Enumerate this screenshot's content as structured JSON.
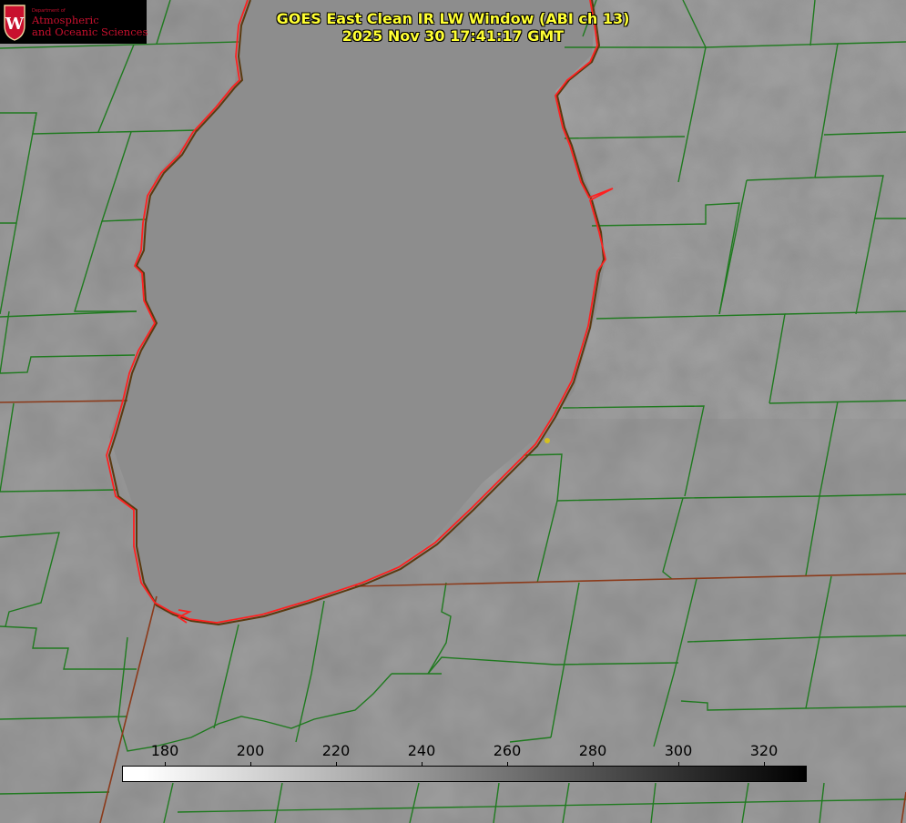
{
  "title": {
    "line1": "GOES East Clean IR LW Window (ABI ch 13)",
    "line2": "2025 Nov 30 17:41:17 GMT"
  },
  "logo": {
    "department": "Department of",
    "line1": "Atmospheric",
    "line2": "and Oceanic Sciences",
    "crest_letter": "W",
    "brand_color": "#c8102e"
  },
  "colorbar": {
    "ticks": [
      "180",
      "200",
      "220",
      "240",
      "260",
      "280",
      "300",
      "320"
    ],
    "range_min": 170,
    "range_max": 330,
    "color_low": "#ffffff",
    "color_high": "#000000"
  },
  "map": {
    "lake_outline_color": "#ff2020",
    "county_line_color": "#1f7a1f",
    "state_line_color": "#8b3a1a",
    "marker_color": "#d4c020"
  }
}
